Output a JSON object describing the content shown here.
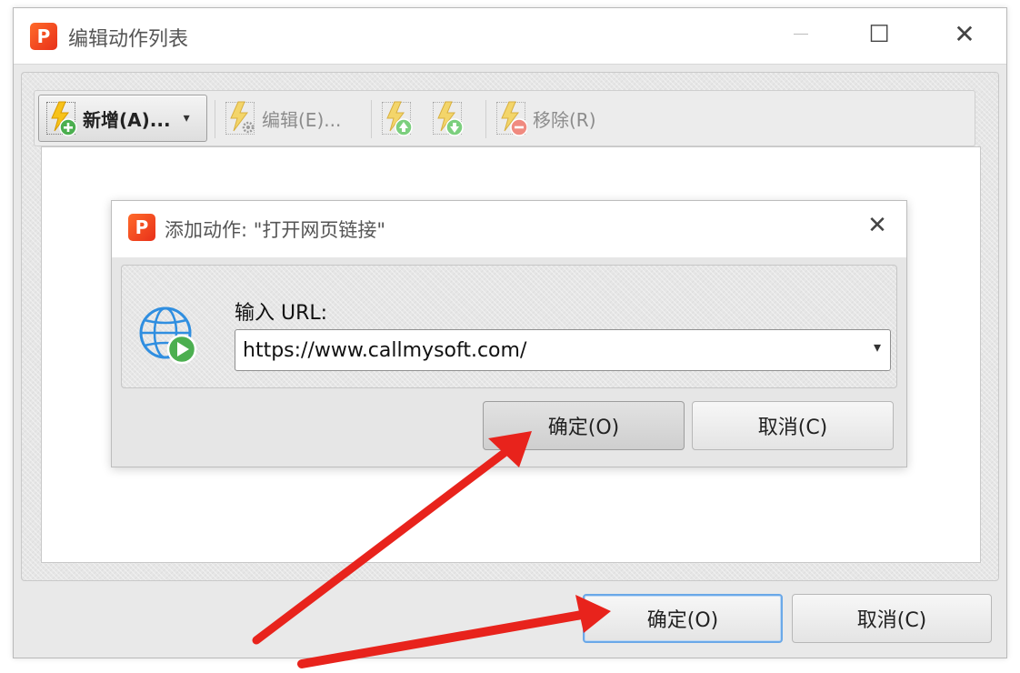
{
  "window": {
    "title": "编辑动作列表",
    "logo_letter": "P",
    "controls": {
      "minimize": "—",
      "maximize": "☐",
      "close": "✕"
    }
  },
  "toolbar": {
    "add_label": "新增(A)...",
    "add_dropdown": "▾",
    "edit_label": "编辑(E)...",
    "remove_label": "移除(R)"
  },
  "footer": {
    "ok_label": "确定(O)",
    "cancel_label": "取消(C)"
  },
  "dialog": {
    "title": "添加动作: \"打开网页链接\"",
    "logo_letter": "P",
    "close": "✕",
    "url_label": "输入 URL:",
    "url_value": "https://www.callmysoft.com/",
    "dropdown": "▾",
    "ok_label": "确定(O)",
    "cancel_label": "取消(C)"
  },
  "colors": {
    "accent_focus": "#6aa8e8",
    "arrow": "#e8231c",
    "logo": "#ef4a23"
  }
}
